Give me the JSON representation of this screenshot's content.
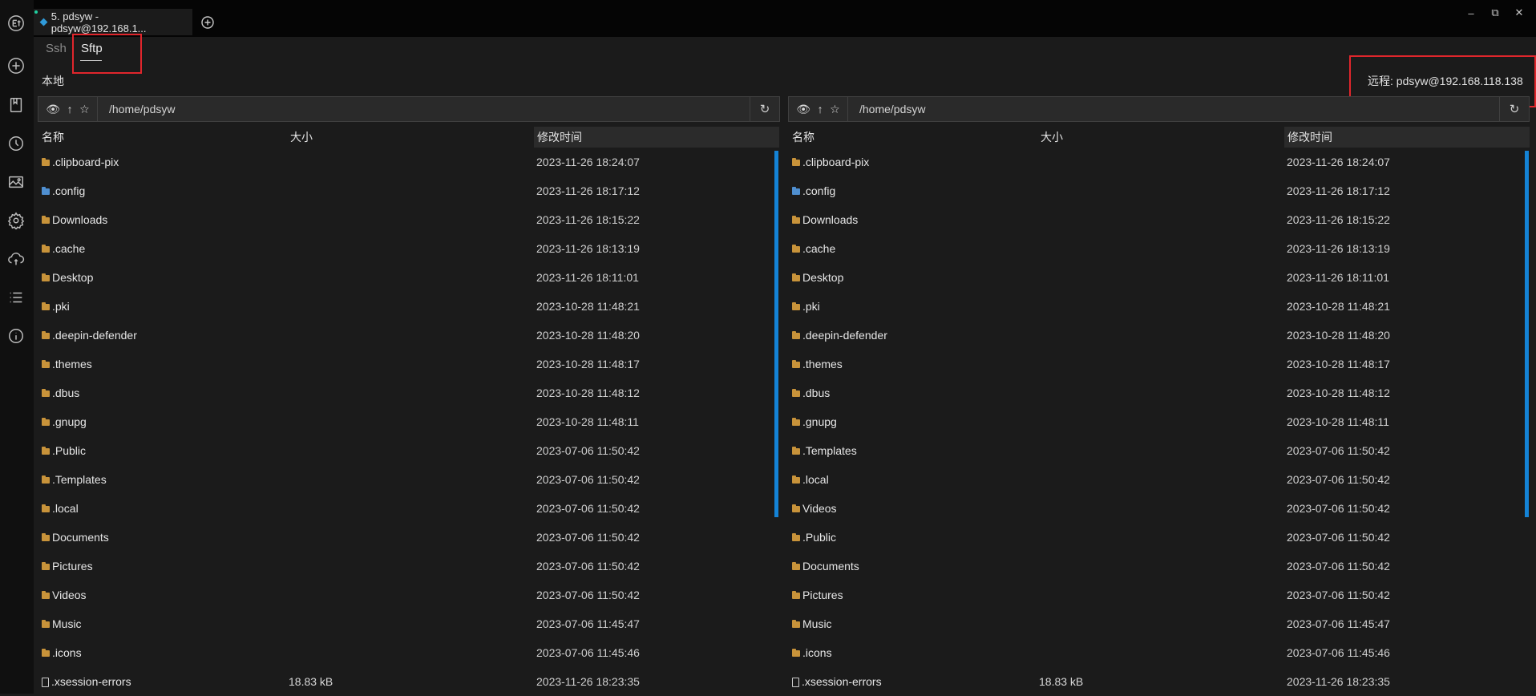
{
  "window": {
    "tab_title": "5. pdsyw - pdsyw@192.168.1...",
    "controls": [
      "minimize",
      "restore",
      "close"
    ]
  },
  "sidebar": {
    "icons": [
      "app-logo-icon",
      "add-circle-icon",
      "bookmark-icon",
      "history-clock-icon",
      "image-icon",
      "settings-gear-icon",
      "cloud-sync-icon",
      "list-icon",
      "info-icon"
    ]
  },
  "subtabs": {
    "ssh": "Ssh",
    "sftp": "Sftp",
    "active": "Sftp"
  },
  "local": {
    "label": "本地",
    "path": "/home/pdsyw",
    "headers": {
      "name": "名称",
      "size": "大小",
      "time": "修改时间"
    },
    "files": [
      {
        "name": ".clipboard-pix",
        "size": "",
        "time": "2023-11-26 18:24:07",
        "type": "folder"
      },
      {
        "name": ".config",
        "size": "",
        "time": "2023-11-26 18:17:12",
        "type": "config"
      },
      {
        "name": "Downloads",
        "size": "",
        "time": "2023-11-26 18:15:22",
        "type": "folder"
      },
      {
        "name": ".cache",
        "size": "",
        "time": "2023-11-26 18:13:19",
        "type": "folder"
      },
      {
        "name": "Desktop",
        "size": "",
        "time": "2023-11-26 18:11:01",
        "type": "folder"
      },
      {
        "name": ".pki",
        "size": "",
        "time": "2023-10-28 11:48:21",
        "type": "folder"
      },
      {
        "name": ".deepin-defender",
        "size": "",
        "time": "2023-10-28 11:48:20",
        "type": "folder"
      },
      {
        "name": ".themes",
        "size": "",
        "time": "2023-10-28 11:48:17",
        "type": "folder"
      },
      {
        "name": ".dbus",
        "size": "",
        "time": "2023-10-28 11:48:12",
        "type": "folder"
      },
      {
        "name": ".gnupg",
        "size": "",
        "time": "2023-10-28 11:48:11",
        "type": "folder"
      },
      {
        "name": ".Public",
        "size": "",
        "time": "2023-07-06 11:50:42",
        "type": "folder"
      },
      {
        "name": ".Templates",
        "size": "",
        "time": "2023-07-06 11:50:42",
        "type": "folder"
      },
      {
        "name": ".local",
        "size": "",
        "time": "2023-07-06 11:50:42",
        "type": "folder"
      },
      {
        "name": "Documents",
        "size": "",
        "time": "2023-07-06 11:50:42",
        "type": "folder"
      },
      {
        "name": "Pictures",
        "size": "",
        "time": "2023-07-06 11:50:42",
        "type": "folder"
      },
      {
        "name": "Videos",
        "size": "",
        "time": "2023-07-06 11:50:42",
        "type": "folder"
      },
      {
        "name": "Music",
        "size": "",
        "time": "2023-07-06 11:45:47",
        "type": "folder"
      },
      {
        "name": ".icons",
        "size": "",
        "time": "2023-07-06 11:45:46",
        "type": "folder"
      },
      {
        "name": ".xsession-errors",
        "size": "18.83 kB",
        "time": "2023-11-26 18:23:35",
        "type": "file"
      }
    ]
  },
  "remote": {
    "label": "远程: pdsyw@192.168.118.138",
    "path": "/home/pdsyw",
    "headers": {
      "name": "名称",
      "size": "大小",
      "time": "修改时间"
    },
    "files": [
      {
        "name": ".clipboard-pix",
        "size": "",
        "time": "2023-11-26 18:24:07",
        "type": "folder"
      },
      {
        "name": ".config",
        "size": "",
        "time": "2023-11-26 18:17:12",
        "type": "config"
      },
      {
        "name": "Downloads",
        "size": "",
        "time": "2023-11-26 18:15:22",
        "type": "folder"
      },
      {
        "name": ".cache",
        "size": "",
        "time": "2023-11-26 18:13:19",
        "type": "folder"
      },
      {
        "name": "Desktop",
        "size": "",
        "time": "2023-11-26 18:11:01",
        "type": "folder"
      },
      {
        "name": ".pki",
        "size": "",
        "time": "2023-10-28 11:48:21",
        "type": "folder"
      },
      {
        "name": ".deepin-defender",
        "size": "",
        "time": "2023-10-28 11:48:20",
        "type": "folder"
      },
      {
        "name": ".themes",
        "size": "",
        "time": "2023-10-28 11:48:17",
        "type": "folder"
      },
      {
        "name": ".dbus",
        "size": "",
        "time": "2023-10-28 11:48:12",
        "type": "folder"
      },
      {
        "name": ".gnupg",
        "size": "",
        "time": "2023-10-28 11:48:11",
        "type": "folder"
      },
      {
        "name": ".Templates",
        "size": "",
        "time": "2023-07-06 11:50:42",
        "type": "folder"
      },
      {
        "name": ".local",
        "size": "",
        "time": "2023-07-06 11:50:42",
        "type": "folder"
      },
      {
        "name": "Videos",
        "size": "",
        "time": "2023-07-06 11:50:42",
        "type": "folder"
      },
      {
        "name": ".Public",
        "size": "",
        "time": "2023-07-06 11:50:42",
        "type": "folder"
      },
      {
        "name": "Documents",
        "size": "",
        "time": "2023-07-06 11:50:42",
        "type": "folder"
      },
      {
        "name": "Pictures",
        "size": "",
        "time": "2023-07-06 11:50:42",
        "type": "folder"
      },
      {
        "name": "Music",
        "size": "",
        "time": "2023-07-06 11:45:47",
        "type": "folder"
      },
      {
        "name": ".icons",
        "size": "",
        "time": "2023-07-06 11:45:46",
        "type": "folder"
      },
      {
        "name": ".xsession-errors",
        "size": "18.83 kB",
        "time": "2023-11-26 18:23:35",
        "type": "file"
      }
    ]
  },
  "colors": {
    "accent": "#1483d6",
    "highlight_box": "#e0262c",
    "folder": "#c8933a",
    "config_folder": "#4f8fd0"
  }
}
